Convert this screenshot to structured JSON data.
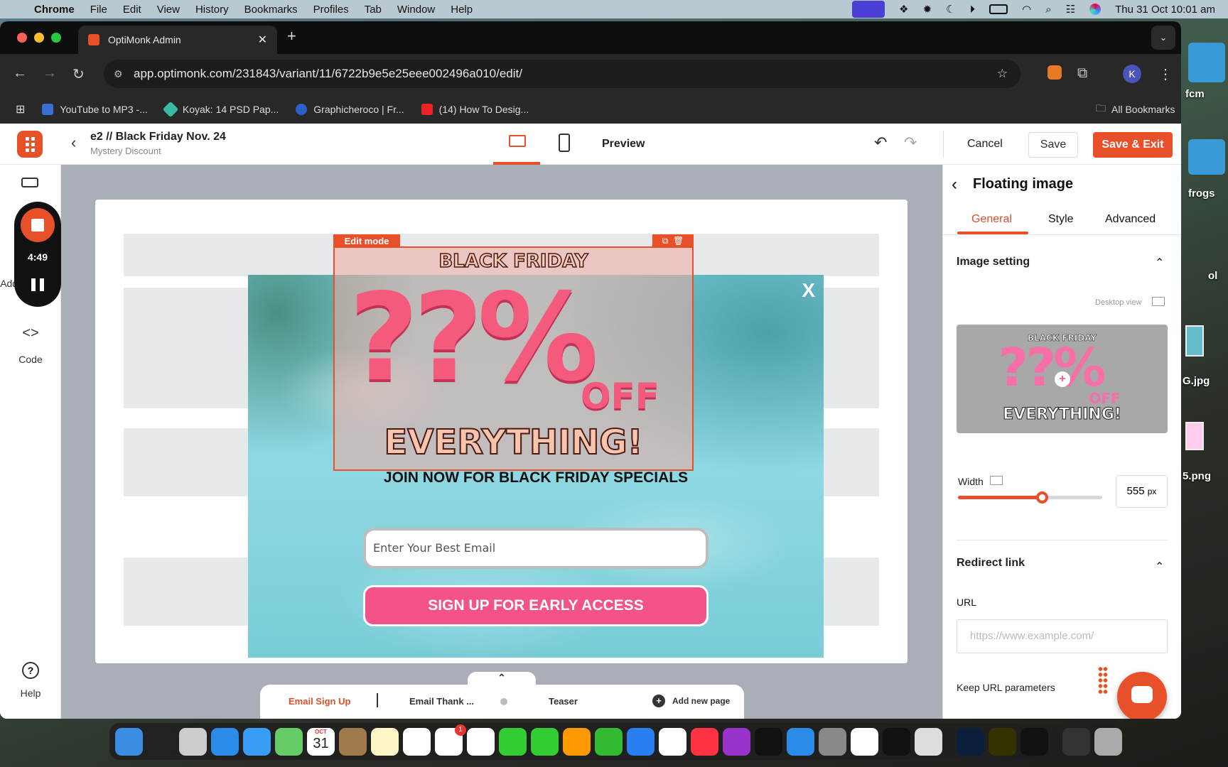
{
  "menubar": {
    "app": "Chrome",
    "items": [
      "File",
      "Edit",
      "View",
      "History",
      "Bookmarks",
      "Profiles",
      "Tab",
      "Window",
      "Help"
    ],
    "clock": "Thu 31 Oct  10:01 am"
  },
  "browser": {
    "tab_title": "OptiMonk Admin",
    "url": "app.optimonk.com/231843/variant/11/6722b9e5e25eee002496a010/edit/",
    "bookmarks": [
      "YouTube to MP3 -...",
      "Koyak: 14 PSD Pap...",
      "Graphicheroco | Fr...",
      "(14) How To Desig..."
    ],
    "all_bookmarks": "All Bookmarks",
    "profile_initial": "K"
  },
  "editor": {
    "campaign_title": "e2 // Black Friday Nov. 24",
    "campaign_subtitle": "Mystery Discount",
    "preview": "Preview",
    "cancel": "Cancel",
    "save": "Save",
    "save_exit": "Save & Exit",
    "accent": "#e8502a"
  },
  "sidebar": {
    "add_elements": "Add elements",
    "code": "Code",
    "help": "Help"
  },
  "recorder": {
    "time": "4:49"
  },
  "popup": {
    "edit_mode": "Edit mode",
    "banner_top": "BLACK FRIDAY",
    "banner_mid": "??%",
    "banner_off": "OFF",
    "banner_bottom": "EVERYTHING!",
    "close": "X",
    "heading": "JOIN NOW FOR BLACK FRIDAY SPECIALS",
    "email_placeholder": "Enter Your Best Email",
    "cta": "SIGN UP FOR EARLY ACCESS",
    "cta_color": "#f4538a"
  },
  "pages": {
    "items": [
      "Email Sign Up",
      "Email Thank ...",
      "Teaser"
    ],
    "active": "Email Sign Up",
    "add": "Add new page"
  },
  "panel": {
    "title": "Floating image",
    "tabs": [
      "General",
      "Style",
      "Advanced"
    ],
    "active_tab": "General",
    "image_setting": "Image setting",
    "desktop_view": "Desktop view",
    "width_label": "Width",
    "width_value": "555",
    "width_unit": "px",
    "width_slider_percent": 58,
    "redirect": "Redirect link",
    "url_label": "URL",
    "url_placeholder": "https://www.example.com/",
    "keep_params": "Keep URL parameters"
  },
  "desktop": {
    "labels": [
      "fcm",
      "frogs",
      "ol",
      "G.jpg",
      "5.png"
    ]
  },
  "dock": {
    "calendar_month": "OCT",
    "calendar_day": "31",
    "reminders_badge": "1",
    "apps": [
      "finder",
      "siri",
      "launchpad",
      "safari",
      "mail",
      "maps",
      "calendar",
      "contacts",
      "notes",
      "freeform",
      "reminders",
      "photos",
      "messages",
      "facetime",
      "pages",
      "numbers",
      "keynote",
      "news",
      "music",
      "podcasts",
      "apple-tv",
      "app-store",
      "system-settings",
      "chrome",
      "spotify",
      "iphone-mirroring",
      "photoshop",
      "illustrator",
      "figma",
      "screenshot",
      "trash"
    ]
  }
}
